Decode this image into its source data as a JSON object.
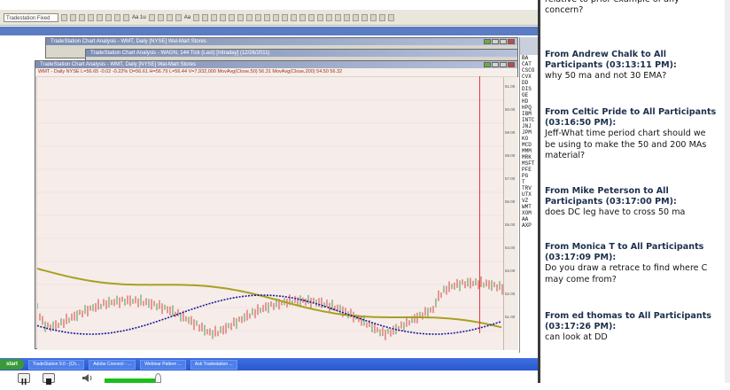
{
  "toolbar": {
    "symbol_field": "Tradestation Fixed",
    "text1": "Aa 1u",
    "text2": "Aa"
  },
  "windows": {
    "back": {
      "title": "TradeStation Chart Analysis - WMT, Daily [NYSE] Wal-Mart Stores"
    },
    "middle": {
      "title": "TradeStation Chart Analysis - WAGN, 144 Tick (Last) [Intraday] (12/26/2011)"
    },
    "front": {
      "title": "TradeStation Chart Analysis - WMT, Daily [NYSE] Wal-Mart Stores",
      "info": "WMT - Daily NYSE  L=56.65 -0.02 -0.22%  O=56.61 H=56.79 L=56.44 V=7,932,000  MovAvg(Close,50) 56.31  MovAvg(Close,200) 54.50  56.32"
    }
  },
  "right_scale": [
    "61.00",
    "60.00",
    "59.00",
    "58.00",
    "57.00",
    "56.00",
    "55.00",
    "54.00",
    "53.00",
    "52.00",
    "51.00"
  ],
  "watchlist": [
    "BA",
    "CAT",
    "CSCO",
    "CVX",
    "DD",
    "DIS",
    "GE",
    "HD",
    "HPQ",
    "IBM",
    "INTC",
    "JNJ",
    "JPM",
    "KO",
    "MCD",
    "MMM",
    "MRK",
    "MSFT",
    "PFE",
    "PG",
    "T",
    "TRV",
    "UTX",
    "VZ",
    "WMT",
    "XOM",
    "AA",
    "AXP"
  ],
  "taskbar": {
    "start": "start",
    "tasks": [
      "TradeStation 9.0 - [Ch...",
      "Adobe Connect - ...",
      "Webinar Pattern ...",
      "Ask Tradestation ..."
    ]
  },
  "chat": [
    {
      "from": "",
      "text": "relative to prior example of any concern?"
    },
    {
      "from": "From Andrew Chalk to All Participants (03:13:11 PM):",
      "text": "why 50 ma and not 30 EMA?"
    },
    {
      "from": "From Celtic Pride to All Participants (03:16:50 PM):",
      "text": "Jeff-What time period chart should we be using to make the 50 and 200 MAs material?"
    },
    {
      "from": "From Mike Peterson to All Participants (03:17:00 PM):",
      "text": "does DC leg have to cross 50 ma"
    },
    {
      "from": "From Monica T to All Participants (03:17:09 PM):",
      "text": "Do you draw a retrace to find where C may come from?"
    },
    {
      "from": "From ed thomas to All Participants (03:17:26 PM):",
      "text": "can look at DD"
    }
  ],
  "colors": {
    "ma_long": "#a8a020",
    "ma_short": "#1a1a9a",
    "price_up": "#d01818",
    "price_dn": "#1a8a1a",
    "taskbar": "#2a58d0"
  }
}
